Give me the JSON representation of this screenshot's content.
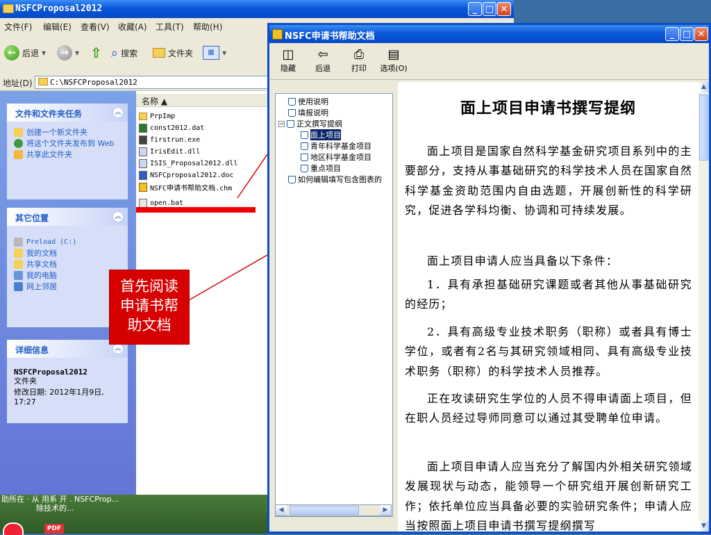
{
  "explorer": {
    "title": "NSFCProposal2012",
    "menu": [
      "文件(F)",
      "编辑(E)",
      "查看(V)",
      "收藏(A)",
      "工具(T)",
      "帮助(H)"
    ],
    "toolbar": {
      "back": "后退",
      "search": "搜索",
      "folders": "文件夹"
    },
    "address_label": "地址(D)",
    "address_value": "C:\\NSFCProposal2012",
    "tasks": {
      "file_tasks_title": "文件和文件夹任务",
      "file_tasks": [
        "创建一个新文件夹",
        "将这个文件夹发布到 Web",
        "共享此文件夹"
      ],
      "other_places_title": "其它位置",
      "other_places": [
        "Preload (C:)",
        "我的文档",
        "共享文档",
        "我的电脑",
        "网上邻居"
      ],
      "details_title": "详细信息",
      "details_name": "NSFCProposal2012",
      "details_type": "文件夹",
      "details_modified": "修改日期: 2012年1月9日, 17:27"
    },
    "column_name": "名称 ▲",
    "files": [
      "PrpImp",
      "const2012.dat",
      "firstrun.exe",
      "IrisEdit.dll",
      "ISIS_Proposal2012.dll",
      "NSFCproposal2012.doc",
      "NSFC申请书帮助文档.chm",
      "open.bat"
    ]
  },
  "callout": {
    "line1": "首先阅读",
    "line2": "申请书帮",
    "line3": "助文档"
  },
  "desktop": {
    "caption_line1": "助所在 · 从 用系 开 . NSFCProp...",
    "caption_line2": "除技术的..."
  },
  "help": {
    "title": "NSFC申请书帮助文档",
    "toolbar": {
      "hide": "隐藏",
      "back": "后退",
      "print": "打印",
      "options": "选项(O)"
    },
    "toc": {
      "item1": "使用说明",
      "item2": "填报说明",
      "item3": "正文撰写提纲",
      "item3_children": [
        "面上项目",
        "青年科学基金项目",
        "地区科学基金项目",
        "重点项目"
      ],
      "item4": "如何编辑填写包含图表的"
    },
    "content": {
      "heading": "面上项目申请书撰写提纲",
      "p1": "面上项目是国家自然科学基金研究项目系列中的主要部分，支持从事基础研究的科学技术人员在国家自然科学基金资助范围内自由选题，开展创新性的科学研究，促进各学科均衡、协调和可持续发展。",
      "p2": "面上项目申请人应当具备以下条件：",
      "p3": "1．具有承担基础研究课题或者其他从事基础研究的经历；",
      "p4": "2．具有高级专业技术职务（职称）或者具有博士学位，或者有2名与其研究领域相同、具有高级专业技术职务（职称）的科学技术人员推荐。",
      "p5": "正在攻读研究生学位的人员不得申请面上项目，但在职人员经过导师同意可以通过其受聘单位申请。",
      "p6": "面上项目申请人应当充分了解国内外相关研究领域发展现状与动态，能领导一个研究组开展创新研究工作；依托单位应当具备必要的实验研究条件；申请人应当按照面上项目申请书撰写提纲撰写"
    }
  },
  "colors": {
    "xp_blue": "#0a58d8",
    "task_pane": "#6f8ee0",
    "callout_red": "#d60000"
  }
}
